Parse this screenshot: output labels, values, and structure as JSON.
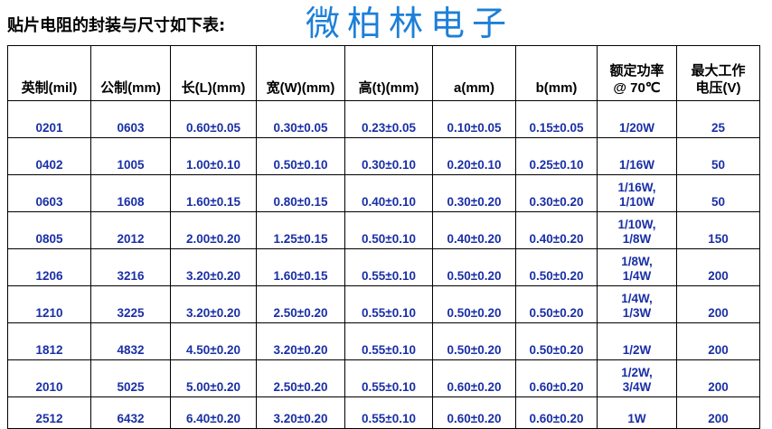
{
  "heading": {
    "title": "贴片电阻的封装与尺寸如下表:",
    "brand": "微柏林电子"
  },
  "table": {
    "headers": [
      [
        "英制(mil)"
      ],
      [
        "公制(mm)"
      ],
      [
        "长(L)(mm)"
      ],
      [
        "宽(W)(mm)"
      ],
      [
        "高(t)(mm)"
      ],
      [
        "a(mm)"
      ],
      [
        "b(mm)"
      ],
      [
        "额定功率",
        "@ 70℃"
      ],
      [
        "最大工作",
        "电压(V)"
      ]
    ],
    "rows": [
      [
        [
          "0201"
        ],
        [
          "0603"
        ],
        [
          "0.60±0.05"
        ],
        [
          "0.30±0.05"
        ],
        [
          "0.23±0.05"
        ],
        [
          "0.10±0.05"
        ],
        [
          "0.15±0.05"
        ],
        [
          "1/20W"
        ],
        [
          "25"
        ]
      ],
      [
        [
          "0402"
        ],
        [
          "1005"
        ],
        [
          "1.00±0.10"
        ],
        [
          "0.50±0.10"
        ],
        [
          "0.30±0.10"
        ],
        [
          "0.20±0.10"
        ],
        [
          "0.25±0.10"
        ],
        [
          "1/16W"
        ],
        [
          "50"
        ]
      ],
      [
        [
          "0603"
        ],
        [
          "1608"
        ],
        [
          "1.60±0.15"
        ],
        [
          "0.80±0.15"
        ],
        [
          "0.40±0.10"
        ],
        [
          "0.30±0.20"
        ],
        [
          "0.30±0.20"
        ],
        [
          "1/16W,",
          "1/10W"
        ],
        [
          "50"
        ]
      ],
      [
        [
          "0805"
        ],
        [
          "2012"
        ],
        [
          "2.00±0.20"
        ],
        [
          "1.25±0.15"
        ],
        [
          "0.50±0.10"
        ],
        [
          "0.40±0.20"
        ],
        [
          "0.40±0.20"
        ],
        [
          "1/10W,",
          "1/8W"
        ],
        [
          "150"
        ]
      ],
      [
        [
          "1206"
        ],
        [
          "3216"
        ],
        [
          "3.20±0.20"
        ],
        [
          "1.60±0.15"
        ],
        [
          "0.55±0.10"
        ],
        [
          "0.50±0.20"
        ],
        [
          "0.50±0.20"
        ],
        [
          "1/8W,",
          "1/4W"
        ],
        [
          "200"
        ]
      ],
      [
        [
          "1210"
        ],
        [
          "3225"
        ],
        [
          "3.20±0.20"
        ],
        [
          "2.50±0.20"
        ],
        [
          "0.55±0.10"
        ],
        [
          "0.50±0.20"
        ],
        [
          "0.50±0.20"
        ],
        [
          "1/4W,",
          "1/3W"
        ],
        [
          "200"
        ]
      ],
      [
        [
          "1812"
        ],
        [
          "4832"
        ],
        [
          "4.50±0.20"
        ],
        [
          "3.20±0.20"
        ],
        [
          "0.55±0.10"
        ],
        [
          "0.50±0.20"
        ],
        [
          "0.50±0.20"
        ],
        [
          "1/2W"
        ],
        [
          "200"
        ]
      ],
      [
        [
          "2010"
        ],
        [
          "5025"
        ],
        [
          "5.00±0.20"
        ],
        [
          "2.50±0.20"
        ],
        [
          "0.55±0.10"
        ],
        [
          "0.60±0.20"
        ],
        [
          "0.60±0.20"
        ],
        [
          "1/2W,",
          "3/4W"
        ],
        [
          "200"
        ]
      ],
      [
        [
          "2512"
        ],
        [
          "6432"
        ],
        [
          "6.40±0.20"
        ],
        [
          "3.20±0.20"
        ],
        [
          "0.55±0.10"
        ],
        [
          "0.60±0.20"
        ],
        [
          "0.60±0.20"
        ],
        [
          "1W"
        ],
        [
          "200"
        ]
      ]
    ]
  }
}
